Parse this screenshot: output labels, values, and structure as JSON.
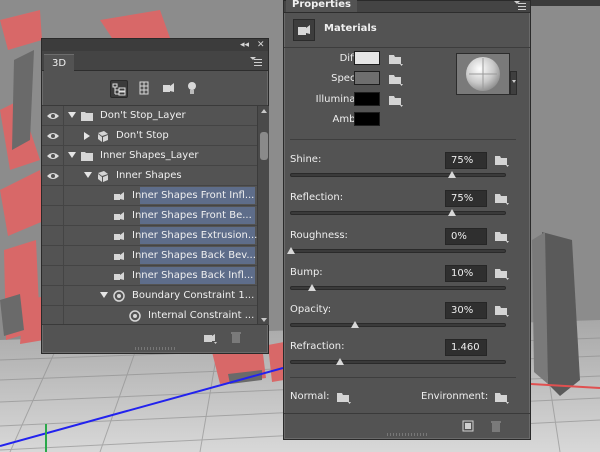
{
  "colors": {
    "panel_bg": "#535353",
    "selection": "#5e6d8a",
    "text_3d_red": "#d86868",
    "axis_blue": "#2222ee",
    "axis_red": "#e05050",
    "axis_green": "#2aa84a"
  },
  "panel3d": {
    "tab_label": "3D",
    "collapse_glyph": "◂◂",
    "close_glyph": "✕",
    "filter_icons": [
      "scene-filter-icon",
      "mesh-filter-icon",
      "material-filter-icon",
      "light-filter-icon"
    ],
    "tree": [
      {
        "label": "Don't Stop_Layer",
        "indent": 0,
        "twisty": "down",
        "icon": "folder-icon",
        "visible": true,
        "selected": false
      },
      {
        "label": "Don't Stop",
        "indent": 1,
        "twisty": "right",
        "icon": "mesh-icon",
        "visible": true,
        "selected": false
      },
      {
        "label": "Inner Shapes_Layer",
        "indent": 0,
        "twisty": "down",
        "icon": "folder-icon",
        "visible": true,
        "selected": false
      },
      {
        "label": "Inner Shapes",
        "indent": 1,
        "twisty": "down",
        "icon": "mesh-icon",
        "visible": true,
        "selected": false
      },
      {
        "label": "Inner Shapes Front Infl...",
        "indent": 2,
        "twisty": "",
        "icon": "material-icon",
        "visible": false,
        "selected": true
      },
      {
        "label": "Inner Shapes Front Be...",
        "indent": 2,
        "twisty": "",
        "icon": "material-icon",
        "visible": false,
        "selected": true
      },
      {
        "label": "Inner Shapes Extrusion...",
        "indent": 2,
        "twisty": "",
        "icon": "material-icon",
        "visible": false,
        "selected": true
      },
      {
        "label": "Inner Shapes Back Bev...",
        "indent": 2,
        "twisty": "",
        "icon": "material-icon",
        "visible": false,
        "selected": true
      },
      {
        "label": "Inner Shapes Back Infl...",
        "indent": 2,
        "twisty": "",
        "icon": "material-icon",
        "visible": false,
        "selected": true
      },
      {
        "label": "Boundary Constraint 1...",
        "indent": 2,
        "twisty": "down",
        "icon": "constraint-icon",
        "visible": false,
        "selected": false
      },
      {
        "label": "Internal Constraint ...",
        "indent": 3,
        "twisty": "",
        "icon": "constraint-icon",
        "visible": false,
        "selected": false
      }
    ]
  },
  "properties": {
    "tab_label": "Properties",
    "section_title": "Materials",
    "colors": [
      {
        "label": "Diffuse:",
        "swatch": "#e6e6e6"
      },
      {
        "label": "Specular:",
        "swatch": "#6e6e6e"
      },
      {
        "label": "Illumination:",
        "swatch": "#000000"
      },
      {
        "label": "Ambient:",
        "swatch": "#000000"
      }
    ],
    "params": [
      {
        "label": "Shine:",
        "value": "75%",
        "level": 0.75,
        "has_folder": true
      },
      {
        "label": "Reflection:",
        "value": "75%",
        "level": 0.75,
        "has_folder": true
      },
      {
        "label": "Roughness:",
        "value": "0%",
        "level": 0.0,
        "has_folder": true
      },
      {
        "label": "Bump:",
        "value": "10%",
        "level": 0.1,
        "has_folder": true
      },
      {
        "label": "Opacity:",
        "value": "30%",
        "level": 0.3,
        "has_folder": true
      },
      {
        "label": "Refraction:",
        "value": "1.460",
        "level": 0.23,
        "has_folder": false
      }
    ],
    "normal_label": "Normal:",
    "environment_label": "Environment:"
  }
}
